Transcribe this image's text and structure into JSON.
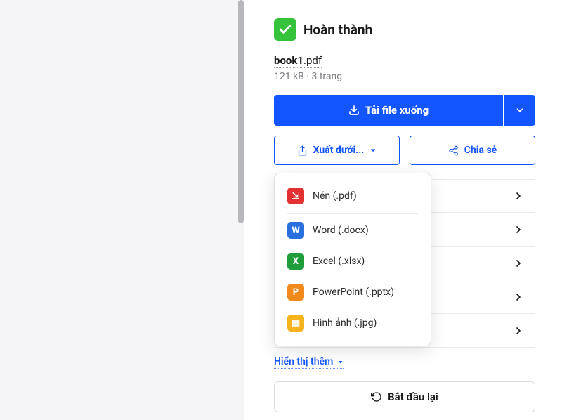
{
  "status": {
    "label": "Hoàn thành"
  },
  "file": {
    "name": "book1",
    "ext": ".pdf",
    "meta": "121 kB · 3 trang"
  },
  "buttons": {
    "download": "Tải file xuống",
    "export": "Xuất dưới...",
    "share": "Chia sẻ",
    "restart": "Bắt đầu lại"
  },
  "export_menu": {
    "items": [
      {
        "label": "Nén (.pdf)",
        "icon_bg": "#e33131",
        "icon_letter": "⇲"
      },
      {
        "label": "Word (.docx)",
        "icon_bg": "#2a6fde",
        "icon_letter": "W"
      },
      {
        "label": "Excel (.xlsx)",
        "icon_bg": "#1f9d3a",
        "icon_letter": "X"
      },
      {
        "label": "PowerPoint (.pptx)",
        "icon_bg": "#f08a1d",
        "icon_letter": "P"
      },
      {
        "label": "Hình ảnh (.jpg)",
        "icon_bg": "#f5b41e",
        "icon_letter": "▦"
      }
    ]
  },
  "show_more": "Hiển thị thêm"
}
